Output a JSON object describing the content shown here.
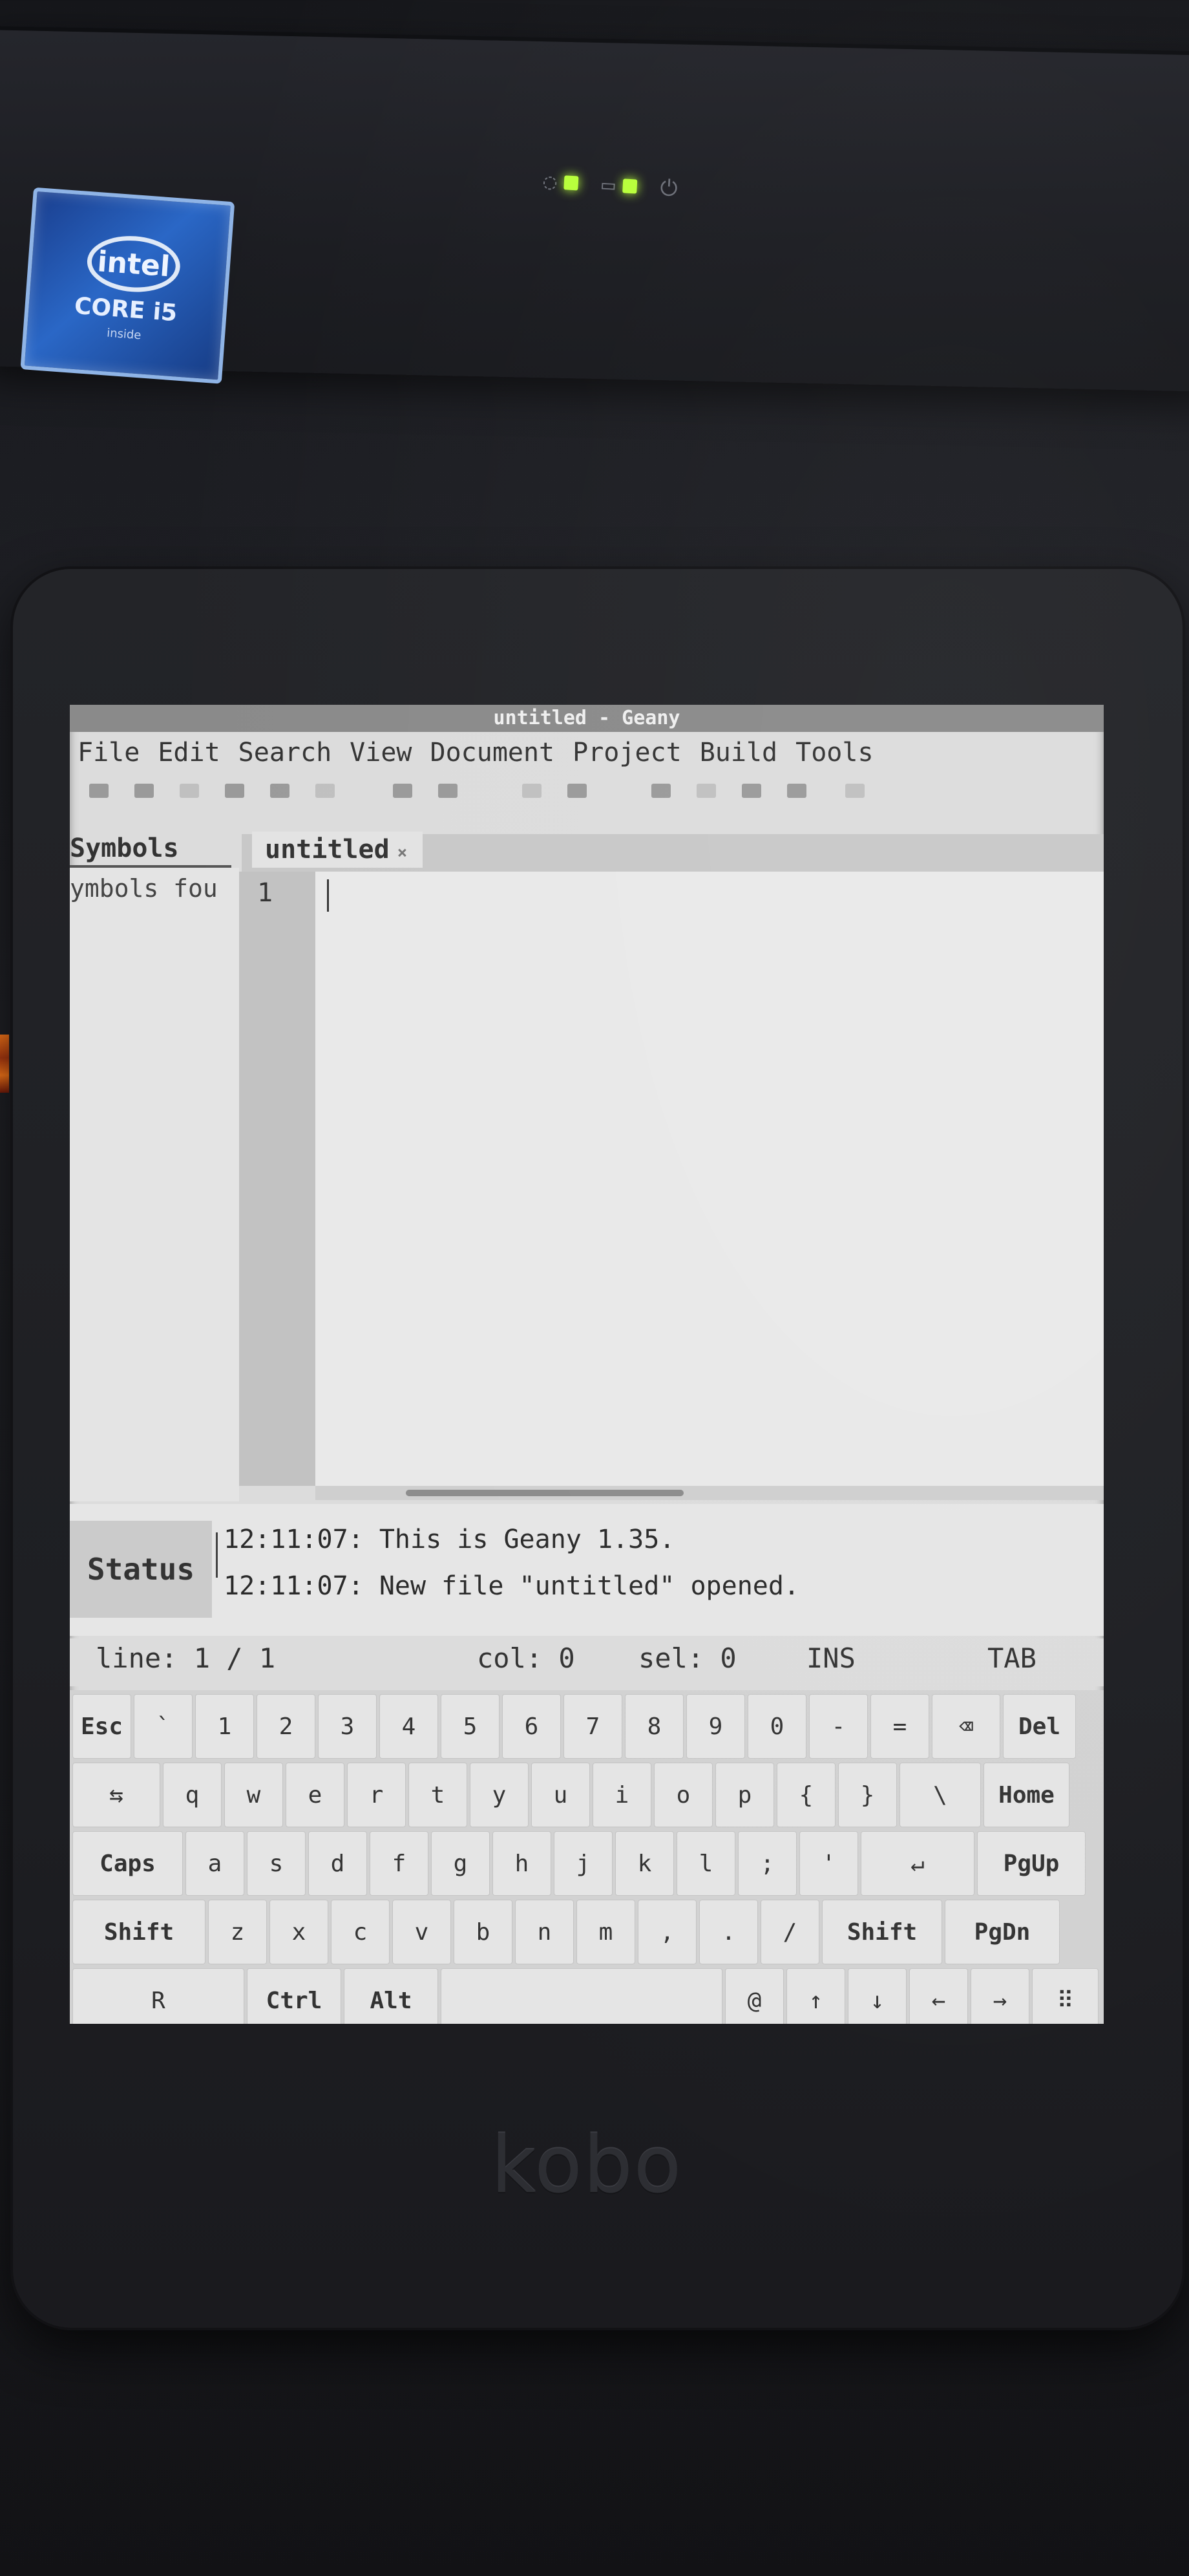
{
  "photo": {
    "laptop_badge": {
      "brand": "intel",
      "line": "CORE i5",
      "sub": "inside"
    },
    "device_brand": "kobo"
  },
  "window": {
    "title": "untitled - Geany"
  },
  "menubar": [
    "File",
    "Edit",
    "Search",
    "View",
    "Document",
    "Project",
    "Build",
    "Tools"
  ],
  "sidebar": {
    "tab": "Symbols",
    "text": "ymbols fou"
  },
  "editor": {
    "tab": "untitled",
    "tab_close": "×",
    "line_number": "1"
  },
  "status_pane": {
    "label": "Status",
    "messages": [
      "12:11:07: This is Geany 1.35.",
      "12:11:07: New file \"untitled\" opened."
    ]
  },
  "statusbar": {
    "line": "line: 1 / 1",
    "col": "col: 0",
    "sel": "sel: 0",
    "mode": "INS",
    "indent": "TAB"
  },
  "keyboard": {
    "rows": [
      [
        "Esc",
        "`",
        "1",
        "2",
        "3",
        "4",
        "5",
        "6",
        "7",
        "8",
        "9",
        "0",
        "-",
        "=",
        "⌫",
        "Del"
      ],
      [
        "⇆",
        "q",
        "w",
        "e",
        "r",
        "t",
        "y",
        "u",
        "i",
        "o",
        "p",
        "{",
        "}",
        "\\",
        "Home"
      ],
      [
        "Caps",
        "a",
        "s",
        "d",
        "f",
        "g",
        "h",
        "j",
        "k",
        "l",
        ";",
        "'",
        "↵",
        "PgUp"
      ],
      [
        "Shift",
        "z",
        "x",
        "c",
        "v",
        "b",
        "n",
        "m",
        ",",
        ".",
        "/",
        "Shift",
        "PgDn"
      ],
      [
        "R",
        "Ctrl",
        "Alt",
        "",
        "@",
        "↑",
        "↓",
        "←",
        "→",
        "⠿"
      ]
    ]
  }
}
